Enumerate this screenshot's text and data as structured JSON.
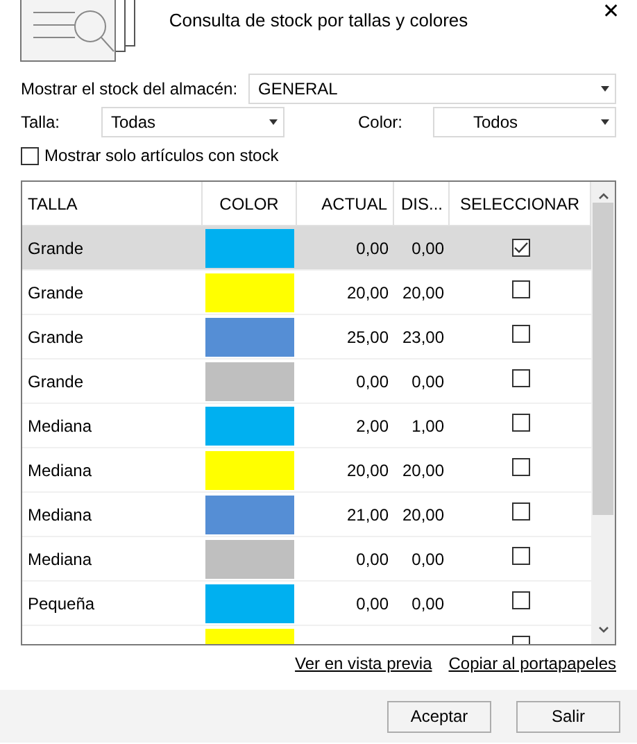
{
  "window": {
    "title": "Consulta de stock por tallas y colores",
    "close": "✕"
  },
  "filters": {
    "warehouse_label": "Mostrar el stock del almacén:",
    "warehouse": "GENERAL",
    "size_label": "Talla:",
    "size": "Todas",
    "color_label": "Color:",
    "color_choice": "Todos"
  },
  "only_stock": {
    "label": "Mostrar solo artículos con stock",
    "checked": false
  },
  "table": {
    "columns": [
      "TALLA",
      "COLOR",
      "ACTUAL",
      "DIS...",
      "SELECCIONAR"
    ],
    "rows": [
      {
        "talla": "Grande",
        "color": "#00b0f0",
        "actual": "0,00",
        "dis": "0,00",
        "checked": true,
        "selected": true
      },
      {
        "talla": "Grande",
        "color": "#ffff00",
        "actual": "20,00",
        "dis": "20,00",
        "checked": false,
        "selected": false
      },
      {
        "talla": "Grande",
        "color": "#558ed5",
        "actual": "25,00",
        "dis": "23,00",
        "checked": false,
        "selected": false
      },
      {
        "talla": "Grande",
        "color": "#bfbfbf",
        "actual": "0,00",
        "dis": "0,00",
        "checked": false,
        "selected": false
      },
      {
        "talla": "Mediana",
        "color": "#00b0f0",
        "actual": "2,00",
        "dis": "1,00",
        "checked": false,
        "selected": false
      },
      {
        "talla": "Mediana",
        "color": "#ffff00",
        "actual": "20,00",
        "dis": "20,00",
        "checked": false,
        "selected": false
      },
      {
        "talla": "Mediana",
        "color": "#558ed5",
        "actual": "21,00",
        "dis": "20,00",
        "checked": false,
        "selected": false
      },
      {
        "talla": "Mediana",
        "color": "#bfbfbf",
        "actual": "0,00",
        "dis": "0,00",
        "checked": false,
        "selected": false
      },
      {
        "talla": "Pequeña",
        "color": "#00b0f0",
        "actual": "0,00",
        "dis": "0,00",
        "checked": false,
        "selected": false
      },
      {
        "color": "#ffff00",
        "selected": false
      }
    ]
  },
  "links": [
    "Ver en vista previa",
    "Copiar al portapapeles"
  ],
  "buttons": [
    "Aceptar",
    "Salir"
  ]
}
